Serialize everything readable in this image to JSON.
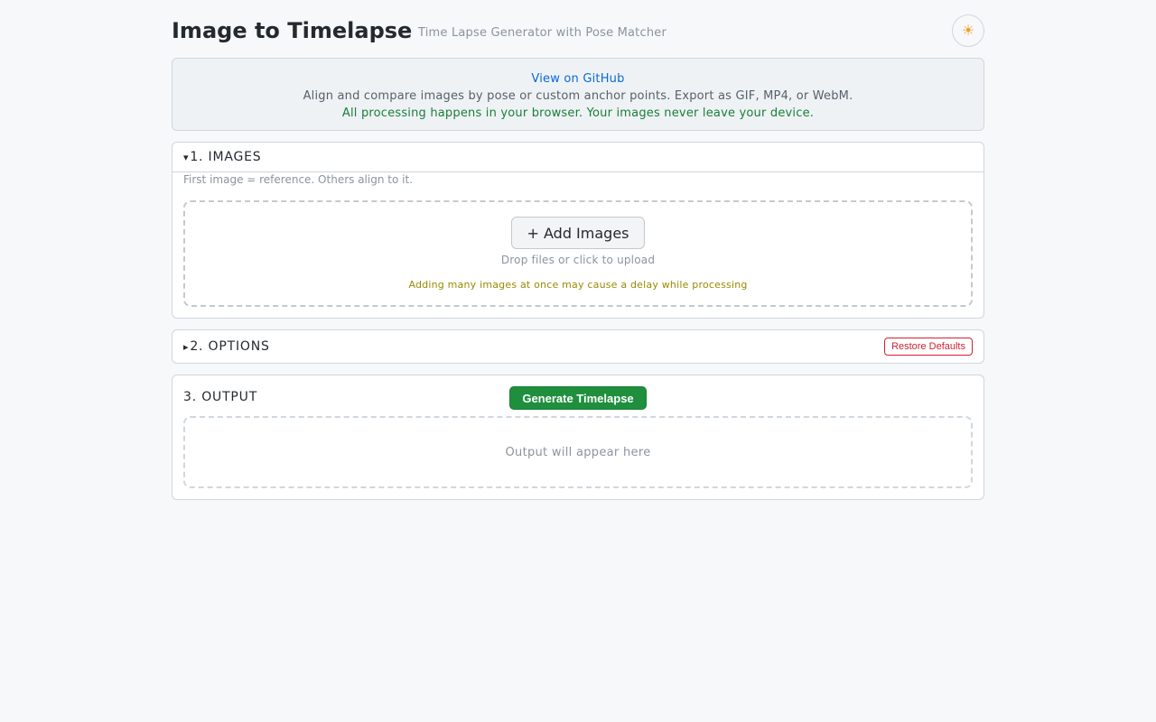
{
  "header": {
    "title": "Image to Timelapse",
    "subtitle": "Time Lapse Generator with Pose Matcher",
    "theme_icon": "sun-icon",
    "theme_glyph": "☀"
  },
  "banner": {
    "github_link": "View on GitHub",
    "description": "Align and compare images by pose or custom anchor points. Export as GIF, MP4, or WebM.",
    "privacy": "All processing happens in your browser. Your images never leave your device."
  },
  "images_section": {
    "caret": "▾",
    "title": "1. IMAGES",
    "hint": "First image = reference. Others align to it.",
    "add_button": "+ Add Images",
    "drop_hint": "Drop files or click to upload",
    "warning": "Adding many images at once may cause a delay while processing"
  },
  "options_section": {
    "caret": "▸",
    "title": "2. OPTIONS",
    "restore_button": "Restore Defaults"
  },
  "output_section": {
    "title": "3. OUTPUT",
    "generate_button": "Generate Timelapse",
    "placeholder": "Output will appear here"
  },
  "colors": {
    "primary_green": "#1f8f3e",
    "link_blue": "#0969da",
    "danger_red": "#cf222e",
    "warning_olive": "#9a8a00",
    "background": "#f6f8fa"
  }
}
